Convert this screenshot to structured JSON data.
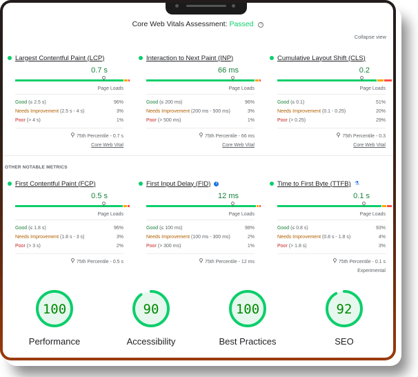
{
  "assessment": {
    "label": "Core Web Vitals Assessment:",
    "status": "Passed",
    "status_color": "#0cce6b",
    "help_icon": "question-circle-icon"
  },
  "collapse_label": "Collapse view",
  "other_metrics_label": "OTHER NOTABLE METRICS",
  "distribution_colors": {
    "good": "#0cce6b",
    "needs_improvement": "#ffa400",
    "poor": "#ff4e42"
  },
  "core_metrics": [
    {
      "title": "Largest Contentful Paint (LCP)",
      "value": "0.7 s",
      "page_loads": "Page Loads",
      "good": {
        "label": "Good",
        "range": "(≤ 2.5 s)",
        "pct": "96%"
      },
      "ni": {
        "label": "Needs Improvement",
        "range": "(2.5 s - 4 s)",
        "pct": "3%"
      },
      "poor": {
        "label": "Poor",
        "range": "(> 4 s)",
        "pct": "1%"
      },
      "dist": [
        96,
        3,
        1
      ],
      "marker": 0.78,
      "percentile": "75th Percentile - 0.7 s",
      "footer": "Core Web Vital"
    },
    {
      "title": "Interaction to Next Paint (INP)",
      "value": "66 ms",
      "page_loads": "Page Loads",
      "good": {
        "label": "Good",
        "range": "(≤ 200 ms)",
        "pct": "96%"
      },
      "ni": {
        "label": "Needs Improvement",
        "range": "(200 ms - 500 ms)",
        "pct": "3%"
      },
      "poor": {
        "label": "Poor",
        "range": "(> 500 ms)",
        "pct": "1%"
      },
      "dist": [
        96,
        3,
        1
      ],
      "marker": 0.76,
      "percentile": "75th Percentile - 66 ms",
      "footer": "Core Web Vital"
    },
    {
      "title": "Cumulative Layout Shift (CLS)",
      "value": "0.2",
      "page_loads": "Page Loads",
      "good": {
        "label": "Good",
        "range": "(≤ 0.1)",
        "pct": "51%"
      },
      "ni": {
        "label": "Needs Improvement",
        "range": "(0.1 - 0.25)",
        "pct": "20%"
      },
      "poor": {
        "label": "Poor",
        "range": "(> 0.25)",
        "pct": "29%"
      },
      "dist": [
        88,
        5,
        7
      ],
      "marker": 0.74,
      "percentile": "75th Percentile - 0.3",
      "footer": "Core Web Vital"
    }
  ],
  "other_metrics": [
    {
      "title": "First Contentful Paint (FCP)",
      "value": "0.5 s",
      "page_loads": "Page Loads",
      "good": {
        "label": "Good",
        "range": "(≤ 1.8 s)",
        "pct": "96%"
      },
      "ni": {
        "label": "Needs Improvement",
        "range": "(1.8 s - 3 s)",
        "pct": "3%"
      },
      "poor": {
        "label": "Poor",
        "range": "(> 3 s)",
        "pct": "2%"
      },
      "dist": [
        95,
        3,
        2
      ],
      "marker": 0.78,
      "percentile": "75th Percentile - 0.5 s"
    },
    {
      "title": "First Input Delay (FID)",
      "title_icon": "info-icon",
      "value": "12 ms",
      "page_loads": "Page Loads",
      "good": {
        "label": "Good",
        "range": "(≤ 100 ms)",
        "pct": "98%"
      },
      "ni": {
        "label": "Needs Improvement",
        "range": "(100 ms - 300 ms)",
        "pct": "2%"
      },
      "poor": {
        "label": "Poor",
        "range": "(> 300 ms)",
        "pct": "1%"
      },
      "dist": [
        97,
        2,
        1
      ],
      "marker": 0.76,
      "percentile": "75th Percentile - 12 ms"
    },
    {
      "title": "Time to First Byte (TTFB)",
      "title_icon": "flask-icon",
      "value": "0.1 s",
      "page_loads": "Page Loads",
      "good": {
        "label": "Good",
        "range": "(≤ 0.8 s)",
        "pct": "93%"
      },
      "ni": {
        "label": "Needs Improvement",
        "range": "(0.8 s - 1.8 s)",
        "pct": "4%"
      },
      "poor": {
        "label": "Poor",
        "range": "(> 1.8 s)",
        "pct": "3%"
      },
      "dist": [
        92,
        4,
        4
      ],
      "marker": 0.76,
      "percentile": "75th Percentile - 0.1 s",
      "footer_plain": "Experimental"
    }
  ],
  "scores": [
    {
      "label": "Performance",
      "score": 100
    },
    {
      "label": "Accessibility",
      "score": 90
    },
    {
      "label": "Best Practices",
      "score": 100
    },
    {
      "label": "SEO",
      "score": 92
    }
  ],
  "gauge_colors": {
    "stroke": "#0cce6b",
    "fill": "#e6f8ee",
    "text": "#008800"
  }
}
